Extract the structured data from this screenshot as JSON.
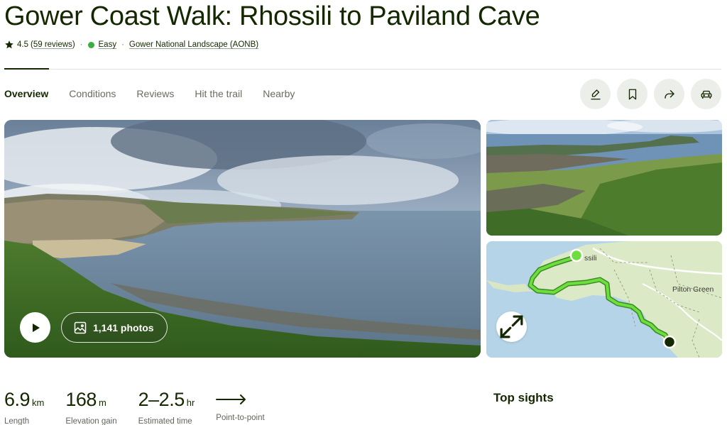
{
  "trail": {
    "title": "Gower Coast Walk: Rhossili to Paviland Cave",
    "rating": "4.5",
    "reviews_link": "59 reviews",
    "difficulty": "Easy",
    "area": "Gower National Landscape (AONB)",
    "difficulty_color": "#3cad41"
  },
  "tabs": [
    {
      "label": "Overview",
      "active": true
    },
    {
      "label": "Conditions"
    },
    {
      "label": "Reviews"
    },
    {
      "label": "Hit the trail"
    },
    {
      "label": "Nearby"
    }
  ],
  "actions": {
    "icons": [
      "edit-icon",
      "bookmark-icon",
      "share-icon",
      "car-icon"
    ]
  },
  "gallery": {
    "photos_label": "1,141 photos"
  },
  "map": {
    "start_label": "ssili",
    "place_label": "Pilton Green",
    "route_color": "#4fc732"
  },
  "stats": {
    "length_value": "6.9",
    "length_unit": "km",
    "length_label": "Length",
    "elevation_value": "168",
    "elevation_unit": "m",
    "elevation_label": "Elevation gain",
    "time_value": "2–2.5",
    "time_unit": "hr",
    "time_label": "Estimated time",
    "route_label": "Point-to-point"
  },
  "sections": {
    "top_sights": "Top sights"
  },
  "colors": {
    "text": "#142800",
    "accent": "#3cad41"
  }
}
